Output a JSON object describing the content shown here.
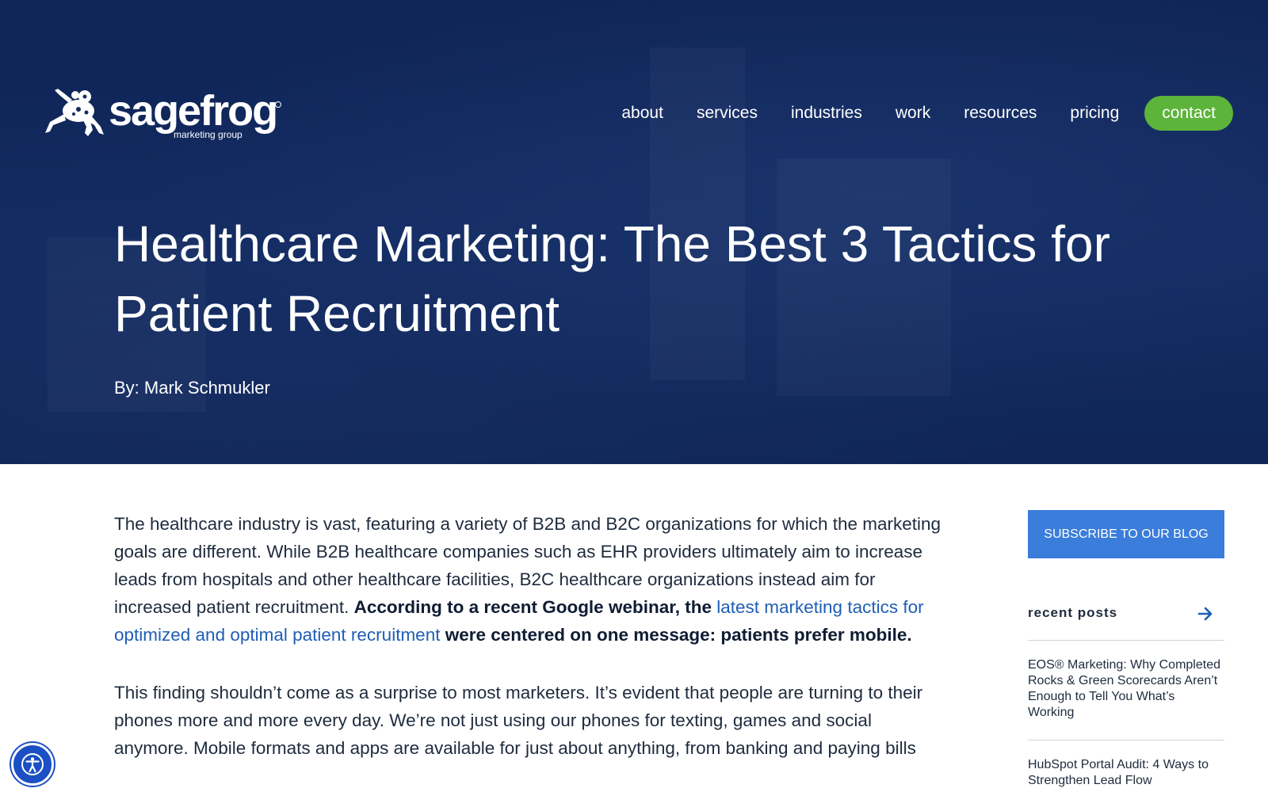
{
  "brand": {
    "name": "sagefrog",
    "tagline": "marketing group",
    "colors": {
      "hero_bg": "#122a60",
      "contact_green": "#5db43a",
      "subscribe_blue": "#3a7ddb",
      "link_blue": "#1f5eb5"
    }
  },
  "nav": {
    "items": [
      {
        "label": "about"
      },
      {
        "label": "services"
      },
      {
        "label": "industries"
      },
      {
        "label": "work"
      },
      {
        "label": "resources"
      },
      {
        "label": "pricing"
      }
    ],
    "contact_label": "contact"
  },
  "hero": {
    "title": "Healthcare Marketing: The Best 3 Tactics for Patient Recruitment",
    "byline": "By: Mark Schmukler"
  },
  "article": {
    "p1_text1": "The healthcare industry is vast, featuring a variety of B2B and B2C organizations for which the marketing goals are different. While B2B healthcare companies such as EHR providers ultimately aim to increase leads from hospitals and other healthcare facilities, B2C healthcare organizations instead aim for increased patient recruitment. ",
    "p1_bold1": "According to a recent Google webinar, the ",
    "p1_link": "latest marketing tactics for optimized and optimal patient recruitment",
    "p1_bold2": " were centered on one message: patients prefer mobile.",
    "p2": "This finding shouldn’t come as a surprise to most marketers. It’s evident that people are turning to their phones more and more every day. We’re not just using our phones for texting, games and social anymore. Mobile formats and apps are available for just about anything, from banking and paying bills"
  },
  "sidebar": {
    "subscribe_label": "SUBSCRIBE TO OUR BLOG",
    "recent_title": "recent posts",
    "posts": [
      {
        "title": "EOS® Marketing: Why Completed Rocks & Green Scorecards Aren’t Enough to Tell You What’s Working"
      },
      {
        "title": "HubSpot Portal Audit: 4 Ways to Strengthen Lead Flow"
      }
    ]
  },
  "icons": {
    "logo": "frog-logo-icon",
    "recent_arrow": "arrow-right-icon",
    "accessibility": "accessibility-icon"
  }
}
